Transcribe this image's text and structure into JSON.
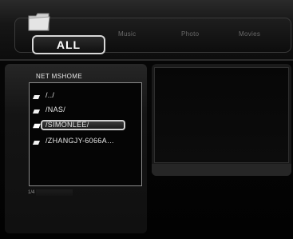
{
  "tabs": {
    "active": "ALL",
    "others": [
      "Music",
      "Photo",
      "Movies"
    ]
  },
  "browser": {
    "path": "NET  MSHOME",
    "items": [
      {
        "label": "/../",
        "selected": false
      },
      {
        "label": "/NAS/",
        "selected": false
      },
      {
        "label": "/SIMONLEE/",
        "selected": true
      },
      {
        "label": "/ZHANGJY-6066A…",
        "selected": false
      }
    ],
    "page": "1/4"
  },
  "icons": {
    "tab": "folder-icon",
    "item": "network-share-icon"
  },
  "colors": {
    "background": "#050505",
    "text": "#e8e8e8",
    "inactive_tab": "#6a6a6a",
    "highlight_border": "#d0d0d0"
  }
}
